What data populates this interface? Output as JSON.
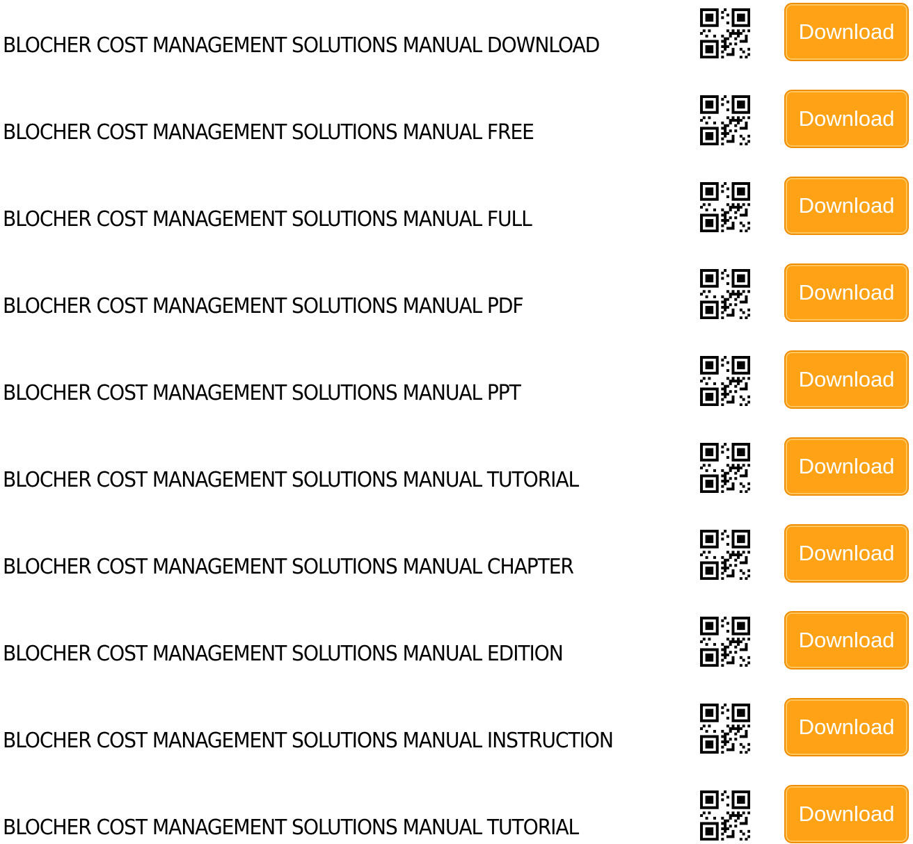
{
  "rows": [
    {
      "title": "BLOCHER COST MANAGEMENT SOLUTIONS MANUAL DOWNLOAD",
      "button": "Download"
    },
    {
      "title": "BLOCHER COST MANAGEMENT SOLUTIONS MANUAL FREE",
      "button": "Download"
    },
    {
      "title": "BLOCHER COST MANAGEMENT SOLUTIONS MANUAL FULL",
      "button": "Download"
    },
    {
      "title": "BLOCHER COST MANAGEMENT SOLUTIONS MANUAL PDF",
      "button": "Download"
    },
    {
      "title": "BLOCHER COST MANAGEMENT SOLUTIONS MANUAL PPT",
      "button": "Download"
    },
    {
      "title": "BLOCHER COST MANAGEMENT SOLUTIONS MANUAL TUTORIAL",
      "button": "Download"
    },
    {
      "title": "BLOCHER COST MANAGEMENT SOLUTIONS MANUAL CHAPTER",
      "button": "Download"
    },
    {
      "title": "BLOCHER COST MANAGEMENT SOLUTIONS MANUAL EDITION",
      "button": "Download"
    },
    {
      "title": "BLOCHER COST MANAGEMENT SOLUTIONS MANUAL INSTRUCTION",
      "button": "Download"
    },
    {
      "title": "BLOCHER COST MANAGEMENT SOLUTIONS MANUAL TUTORIAL",
      "button": "Download"
    }
  ],
  "icons": {
    "qr": "qr-code-icon"
  },
  "colors": {
    "button_bg": "#ffa216",
    "button_border": "#f08c00",
    "button_text": "#ffffff",
    "text": "#000000"
  }
}
